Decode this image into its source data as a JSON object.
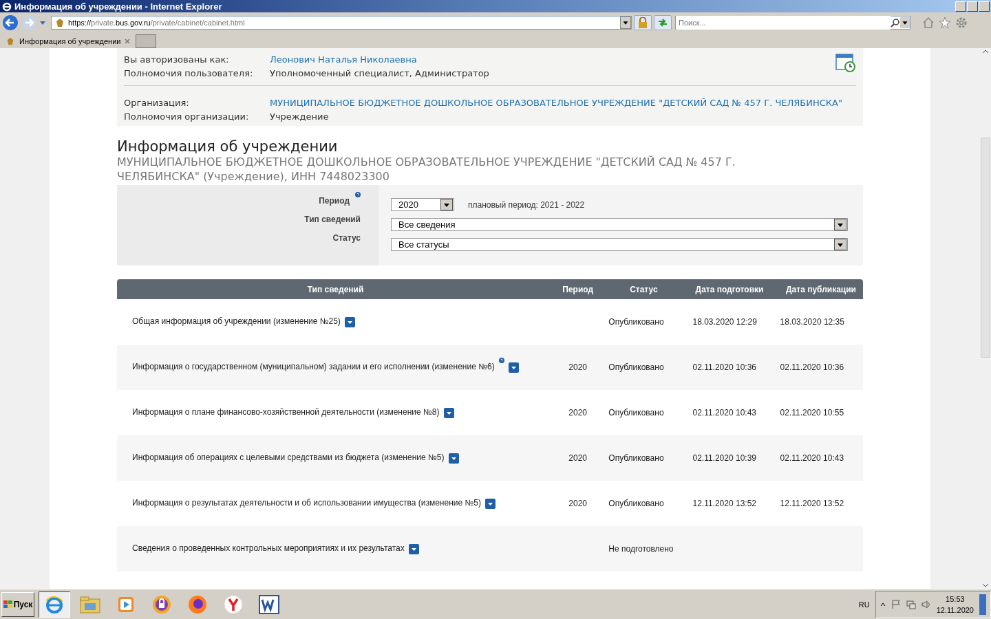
{
  "window": {
    "title": "Информация об учреждении - Internet Explorer"
  },
  "browser": {
    "url_scheme": "https://",
    "url_host_pre": "private.",
    "url_host": "bus.gov.ru",
    "url_path": "/private/cabinet/cabinet.html",
    "search": {
      "placeholder": "Поиск..."
    },
    "tabs": [
      {
        "label": "Информация об учреждении",
        "selected": true
      }
    ]
  },
  "user_panel": {
    "rows": [
      {
        "label": "Вы авторизованы как:",
        "value": "Леонович Наталья Николаевна",
        "kind": "link"
      },
      {
        "label": "Полномочия пользователя:",
        "value": "Уполномоченный специалист, Администратор",
        "kind": "text"
      }
    ],
    "org_rows": [
      {
        "label": "Организация:",
        "value": "МУНИЦИПАЛЬНОЕ БЮДЖЕТНОЕ ДОШКОЛЬНОЕ ОБРАЗОВАТЕЛЬНОЕ УЧРЕЖДЕНИЕ \"ДЕТСКИЙ САД № 457 Г. ЧЕЛЯБИНСКА\"",
        "kind": "link"
      },
      {
        "label": "Полномочия организации:",
        "value": "Учреждение",
        "kind": "text"
      }
    ]
  },
  "heading": "Информация об учреждении",
  "subheading": "МУНИЦИПАЛЬНОЕ БЮДЖЕТНОЕ ДОШКОЛЬНОЕ ОБРАЗОВАТЕЛЬНОЕ УЧРЕЖДЕНИЕ \"ДЕТСКИЙ САД № 457 Г. ЧЕЛЯБИНСКА\" (Учреждение), ИНН 7448023300",
  "filters": {
    "period": {
      "label": "Период",
      "value": "2020",
      "note": "плановый период: 2021 - 2022"
    },
    "type": {
      "label": "Тип сведений",
      "value": "Все сведения"
    },
    "status": {
      "label": "Статус",
      "value": "Все статусы"
    }
  },
  "table": {
    "columns": [
      "Тип сведений",
      "Период",
      "Статус",
      "Дата подготовки",
      "Дата публикации"
    ],
    "rows": [
      {
        "type": "Общая информация об учреждении (изменение №25)",
        "help": false,
        "period": "",
        "status": "Опубликовано",
        "prepared": "18.03.2020 12:29",
        "published": "18.03.2020 12:35"
      },
      {
        "type": "Информация о государственном (муниципальном) задании и его исполнении (изменение №6)",
        "help": true,
        "period": "2020",
        "status": "Опубликовано",
        "prepared": "02.11.2020 10:36",
        "published": "02.11.2020 10:36"
      },
      {
        "type": "Информация о плане финансово-хозяйственной деятельности (изменение №8)",
        "help": false,
        "period": "2020",
        "status": "Опубликовано",
        "prepared": "02.11.2020 10:43",
        "published": "02.11.2020 10:55"
      },
      {
        "type": "Информация об операциях с целевыми средствами из бюджета (изменение №5)",
        "help": false,
        "period": "2020",
        "status": "Опубликовано",
        "prepared": "02.11.2020 10:39",
        "published": "02.11.2020 10:43"
      },
      {
        "type": "Информация о результатах деятельности и об использовании имущества (изменение №5)",
        "help": false,
        "period": "2020",
        "status": "Опубликовано",
        "prepared": "12.11.2020 13:52",
        "published": "12.11.2020 13:52"
      },
      {
        "type": "Сведения о проведенных контрольных мероприятиях и их результатах",
        "help": false,
        "period": "",
        "status": "Не подготовлено",
        "prepared": "",
        "published": ""
      }
    ]
  },
  "taskbar": {
    "start": "Пуск",
    "apps": [
      {
        "kind": "ie",
        "selected": true
      },
      {
        "kind": "folder",
        "selected": false
      },
      {
        "kind": "player",
        "selected": false
      },
      {
        "kind": "shield",
        "selected": false
      },
      {
        "kind": "firefox",
        "selected": false
      },
      {
        "kind": "yandex",
        "selected": false
      },
      {
        "kind": "word",
        "selected": false
      }
    ],
    "lang": "RU",
    "time": "15:53",
    "date": "12.11.2020"
  }
}
